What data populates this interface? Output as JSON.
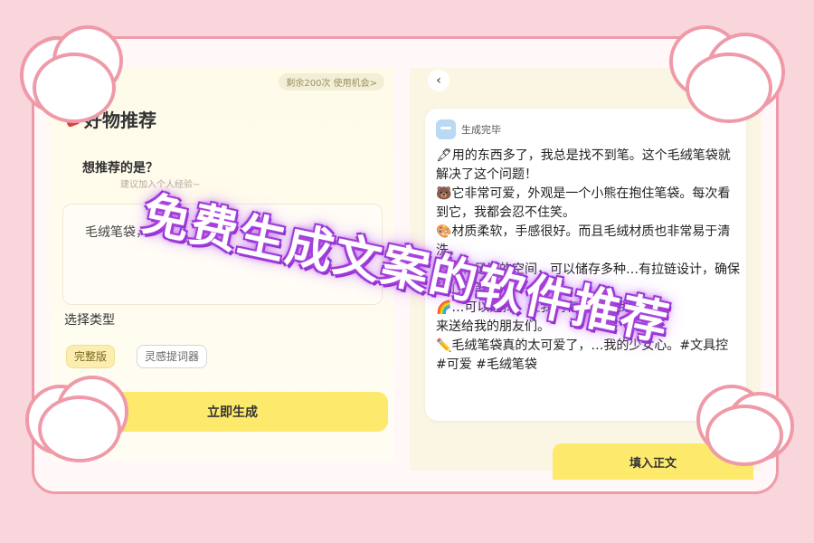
{
  "left_panel": {
    "quota": "剩余200次 使用机会>",
    "title": "好物推荐",
    "question_label": "想推荐的是？",
    "question_hint": "建议加入个人经验~",
    "textarea_value": "毛绒笔袋，",
    "type_label": "选择类型",
    "chips": [
      "完整版",
      "灵感提词器"
    ],
    "generate_button": "立即生成"
  },
  "right_panel": {
    "back_icon": "chevron-left-icon",
    "status": "生成完毕",
    "result_text": "🖋用的东西多了，我总是找不到笔。这个毛绒笔袋就解决了这个问题！\n🐻它非常可爱，外观是一个小熊在抱住笔袋。每次看到它，我都会忍不住笑。\n🎨材质柔软，手感很好。而且毛绒材质也非常易于清洗。\n内部有足够的空间，可以储存多种…有拉链设计，确保我们的笔\n🌈…可以选择，让我们有更多…我\n来送给我的朋友们。\n✏️毛绒笔袋真的太可爱了，…我的少女心。#文具控 #可爱 #毛绒笔袋",
    "fill_button": "填入正文"
  },
  "overlay": {
    "headline": "免费生成文案的软件推荐"
  },
  "colors": {
    "background": "#f9d6dc",
    "frame": "#ef9aa8",
    "accent_yellow": "#fde96c",
    "headline_glow": "#8a2bd1"
  }
}
